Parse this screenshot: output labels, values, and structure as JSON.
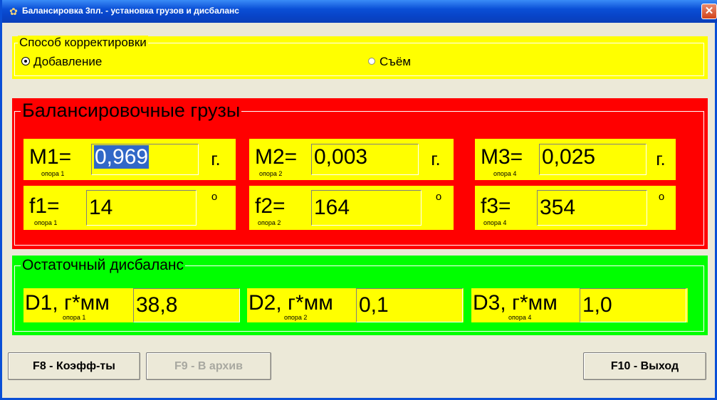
{
  "window": {
    "title": "Балансировка 3пл. - установка грузов и дисбаланс",
    "icon": "gear-icon",
    "close_glyph": "✕"
  },
  "correction_mode": {
    "legend": "Способ корректировки",
    "options": [
      {
        "label": "Добавление",
        "selected": true
      },
      {
        "label": "Съём",
        "selected": false
      }
    ]
  },
  "weights": {
    "legend": "Балансировочные грузы",
    "masses": [
      {
        "label": "M1=",
        "support": "опора 1",
        "value": "0,969",
        "unit": "г."
      },
      {
        "label": "M2=",
        "support": "опора 2",
        "value": "0,003",
        "unit": "г."
      },
      {
        "label": "M3=",
        "support": "опора 4",
        "value": "0,025",
        "unit": "г."
      }
    ],
    "angles": [
      {
        "label": "f1=",
        "support": "опора 1",
        "value": "14",
        "unit": "o"
      },
      {
        "label": "f2=",
        "support": "опора 2",
        "value": "164",
        "unit": "o"
      },
      {
        "label": "f3=",
        "support": "опора 4",
        "value": "354",
        "unit": "o"
      }
    ]
  },
  "residual": {
    "legend": "Остаточный дисбаланс",
    "items": [
      {
        "label": "D1, г*мм",
        "support": "опора 1",
        "value": "38,8"
      },
      {
        "label": "D2, г*мм",
        "support": "опора 2",
        "value": "0,1"
      },
      {
        "label": "D3, г*мм",
        "support": "опора 4",
        "value": "1,0"
      }
    ]
  },
  "buttons": {
    "coefficients": "F8 - Коэфф-ты",
    "archive": "F9 - В архив",
    "exit": "F10 - Выход"
  },
  "colors": {
    "mode_panel": "#ffff00",
    "weights_panel": "#ff0000",
    "residual_panel": "#00ff00",
    "fields": "#ffff00",
    "titlebar": "#0a4fd6"
  }
}
